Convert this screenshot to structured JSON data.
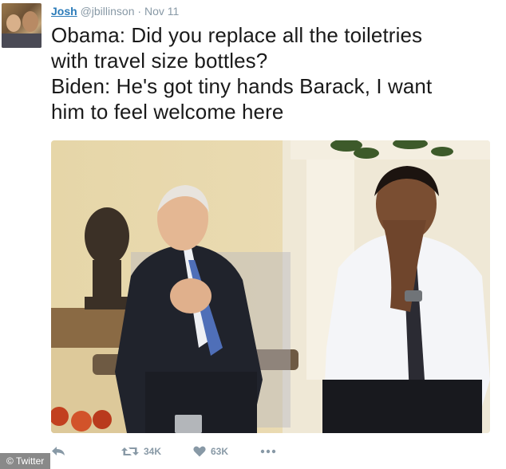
{
  "tweet": {
    "author_name": "Josh",
    "handle": "@jbillinson",
    "separator": "·",
    "date": "Nov 11",
    "lines": [
      "Obama: Did you replace all the toiletries",
      "with travel size bottles?",
      "Biden: He's got tiny hands Barack, I want",
      "him to feel welcome here"
    ]
  },
  "actions": {
    "retweet_count": "34K",
    "like_count": "63K"
  },
  "credit": "© Twitter",
  "icons": {
    "reply": "reply-icon",
    "retweet": "retweet-icon",
    "like": "heart-icon",
    "more": "more-dots-icon"
  },
  "colors": {
    "link": "#2b7bb9",
    "muted": "#8899a6",
    "text": "#1a1a1a"
  }
}
